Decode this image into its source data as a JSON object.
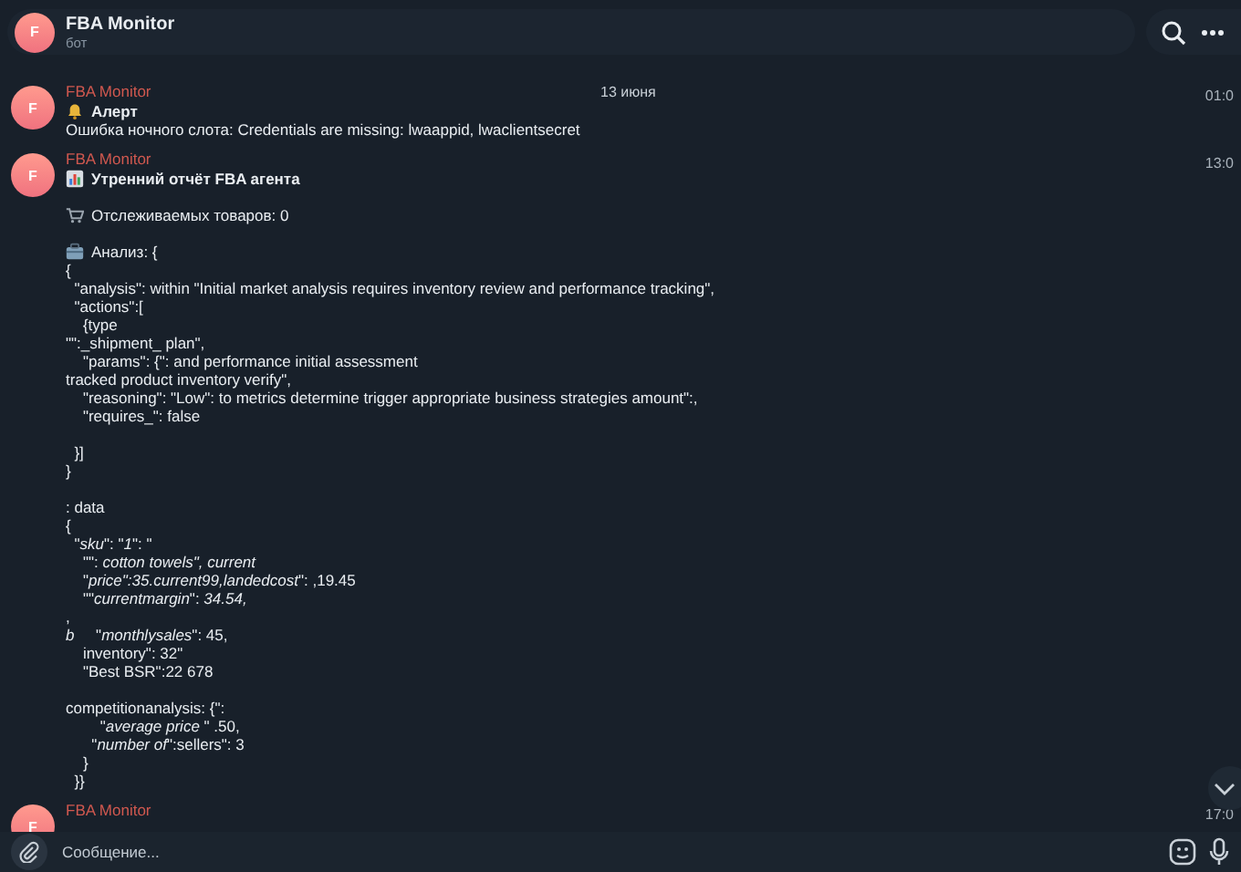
{
  "header": {
    "avatar": "F",
    "title": "FBA Monitor",
    "subtitle": "бот"
  },
  "date_divider": "13 июня",
  "messages": [
    {
      "avatar": "F",
      "sender": "FBA Monitor",
      "time": "01:0",
      "paragraphs": [
        {
          "kind": "alert",
          "lines": [
            "Алерт",
            "Ошибка ночного слота: Credentials are missing: lwaappid, lwaclientsecret"
          ]
        }
      ]
    },
    {
      "avatar": "F",
      "sender": "FBA Monitor",
      "time": "13:0",
      "paragraphs": [
        {
          "kind": "report",
          "lines": [
            "Утренний отчёт FBA агента"
          ]
        },
        {
          "kind": "tracked",
          "lines": [
            "Отслеживаемых товаров: 0"
          ]
        },
        {
          "kind": "analysis",
          "lines": [
            "Анализ: {",
            "{",
            "  \"analysis\": within \"Initial market analysis requires inventory review and performance tracking\",",
            "  \"actions\":[",
            "    {type",
            "\"\":_shipment_ plan\",",
            "    \"params\": {\": and performance initial assessment",
            "tracked product inventory verify\",",
            "    \"reasoning\": \"Low\": to metrics determine trigger appropriate business strategies amount\":,",
            "    \"requires_\": false"
          ]
        },
        {
          "kind": "plain",
          "lines": [
            "  }]",
            "}"
          ]
        },
        {
          "kind": "plain",
          "lines": [
            ": data",
            "{",
            "  \"*sku*\": \"*1*\": \"",
            "    \"\": *cotton towels\", current*",
            "    \"*price\":35.current99,landedcost*\": ,19.45",
            "    \"\"*currentmargin*\": *34.54,*",
            ",",
            "*b*     \"*monthlysales*\": 45,",
            "    inventory\": 32\"",
            "    \"Best BSR\":22 678"
          ]
        },
        {
          "kind": "plain",
          "lines": [
            "competitionanalysis: {\":",
            "        \"*average price* \" .50,",
            "      \"*number of*\":sellers\": 3",
            "    }",
            "  }}"
          ]
        }
      ]
    },
    {
      "avatar": "F",
      "sender": "FBA Monitor",
      "time": "17:0"
    }
  ],
  "composer": {
    "placeholder": "Сообщение..."
  }
}
